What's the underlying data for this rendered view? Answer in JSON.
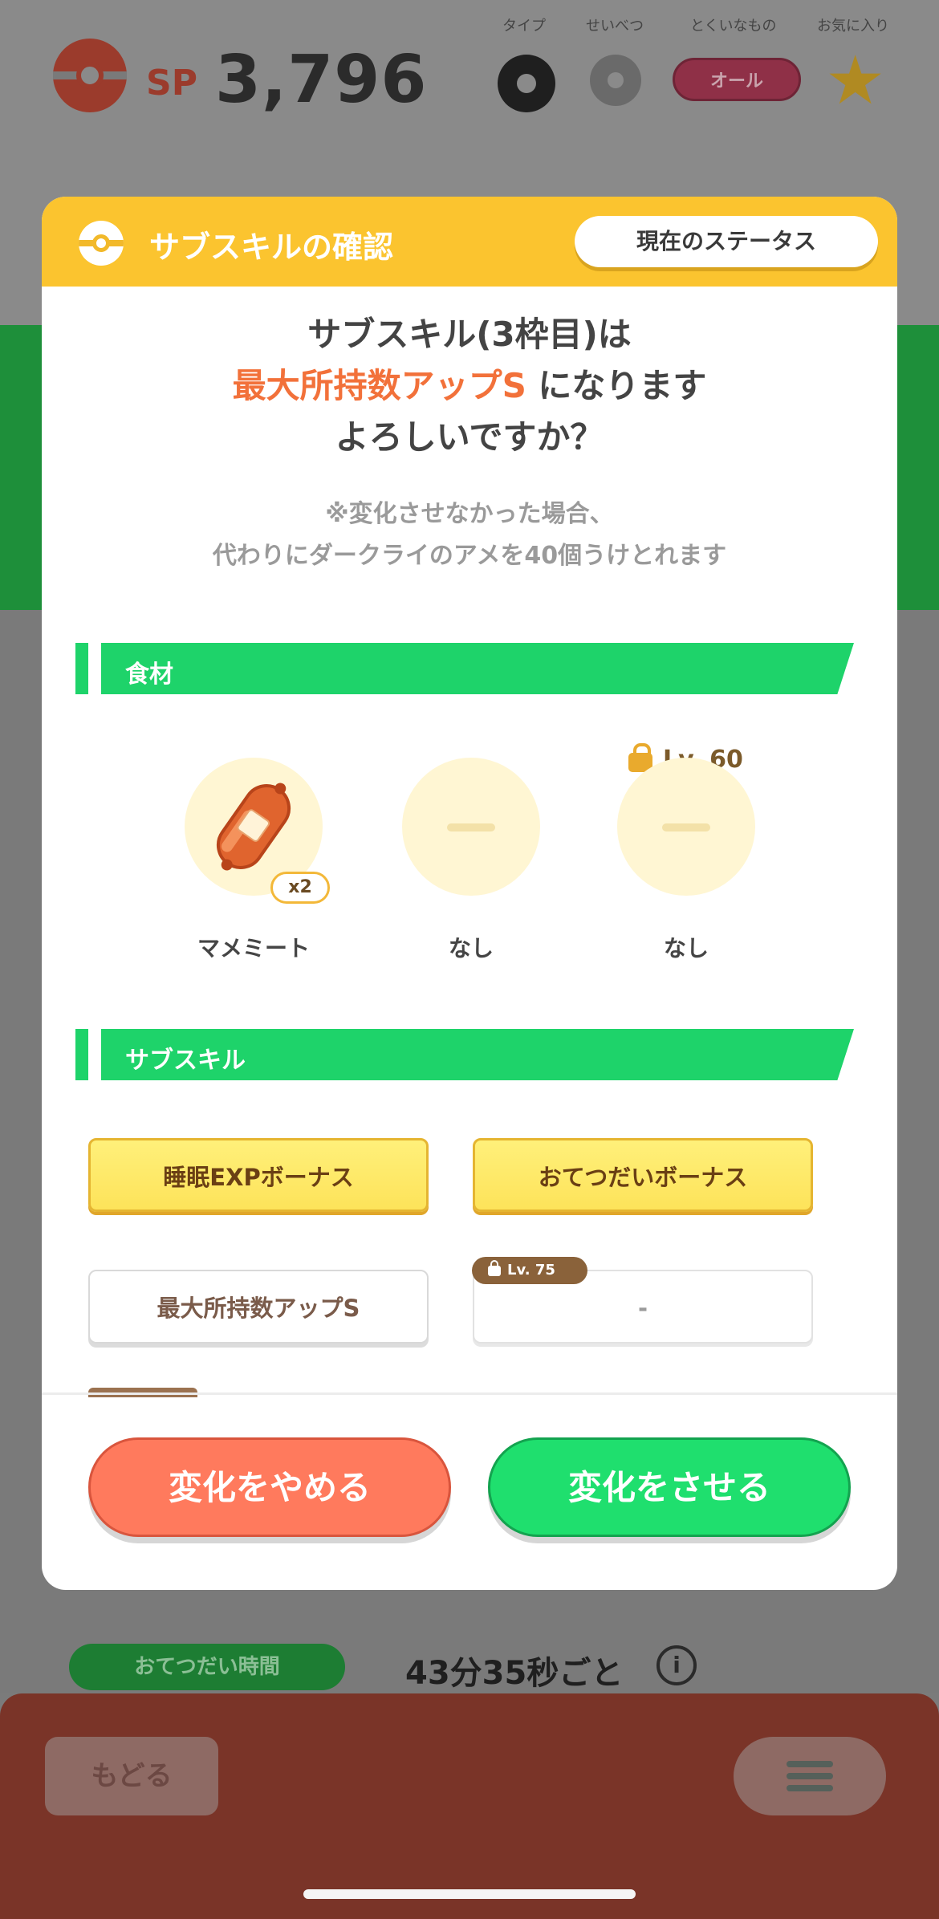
{
  "background": {
    "sp_label": "SP",
    "sp_value": "3,796",
    "filters": {
      "type_label": "タイプ",
      "gender_label": "せいべつ",
      "specialty_label": "とくいなもの",
      "favorite_label": "お気に入り",
      "specialty_value": "オール"
    },
    "help_time_label": "おてつだい時間",
    "help_time_value": "43分35秒ごと",
    "info_icon_glyph": "i",
    "back_label": "もどる"
  },
  "modal": {
    "title": "サブスキルの確認",
    "status_button": "現在のステータス",
    "question": {
      "line1": "サブスキル(3枠目)は",
      "line2_accent": "最大所持数アップS",
      "line2_rest": " になります",
      "line3": "よろしいですか？"
    },
    "note": {
      "line1": "※変化させなかった場合、",
      "line2": "代わりにダークライのアメを40個うけとれます"
    },
    "ingredients_section": {
      "title": "食材",
      "items": [
        {
          "name": "マメミート",
          "count": "x2",
          "icon": "sausage-icon"
        },
        {
          "name": "なし"
        },
        {
          "name": "なし",
          "lock_level": "Lv. 60"
        }
      ]
    },
    "subskills_section": {
      "title": "サブスキル",
      "items": [
        {
          "label": "睡眠EXPボーナス",
          "rarity": "gold"
        },
        {
          "label": "おてつだいボーナス",
          "rarity": "gold"
        },
        {
          "label": "最大所持数アップS",
          "rarity": "white"
        },
        {
          "label": "-",
          "lock_level": "Lv. 75"
        }
      ]
    },
    "buttons": {
      "cancel": "変化をやめる",
      "confirm": "変化をさせる"
    }
  },
  "colors": {
    "header_yellow": "#fbc42f",
    "section_green": "#1ed36a",
    "accent_orange": "#f2713a",
    "cancel_red": "#ff7a5d",
    "confirm_green": "#1fdf6e"
  }
}
